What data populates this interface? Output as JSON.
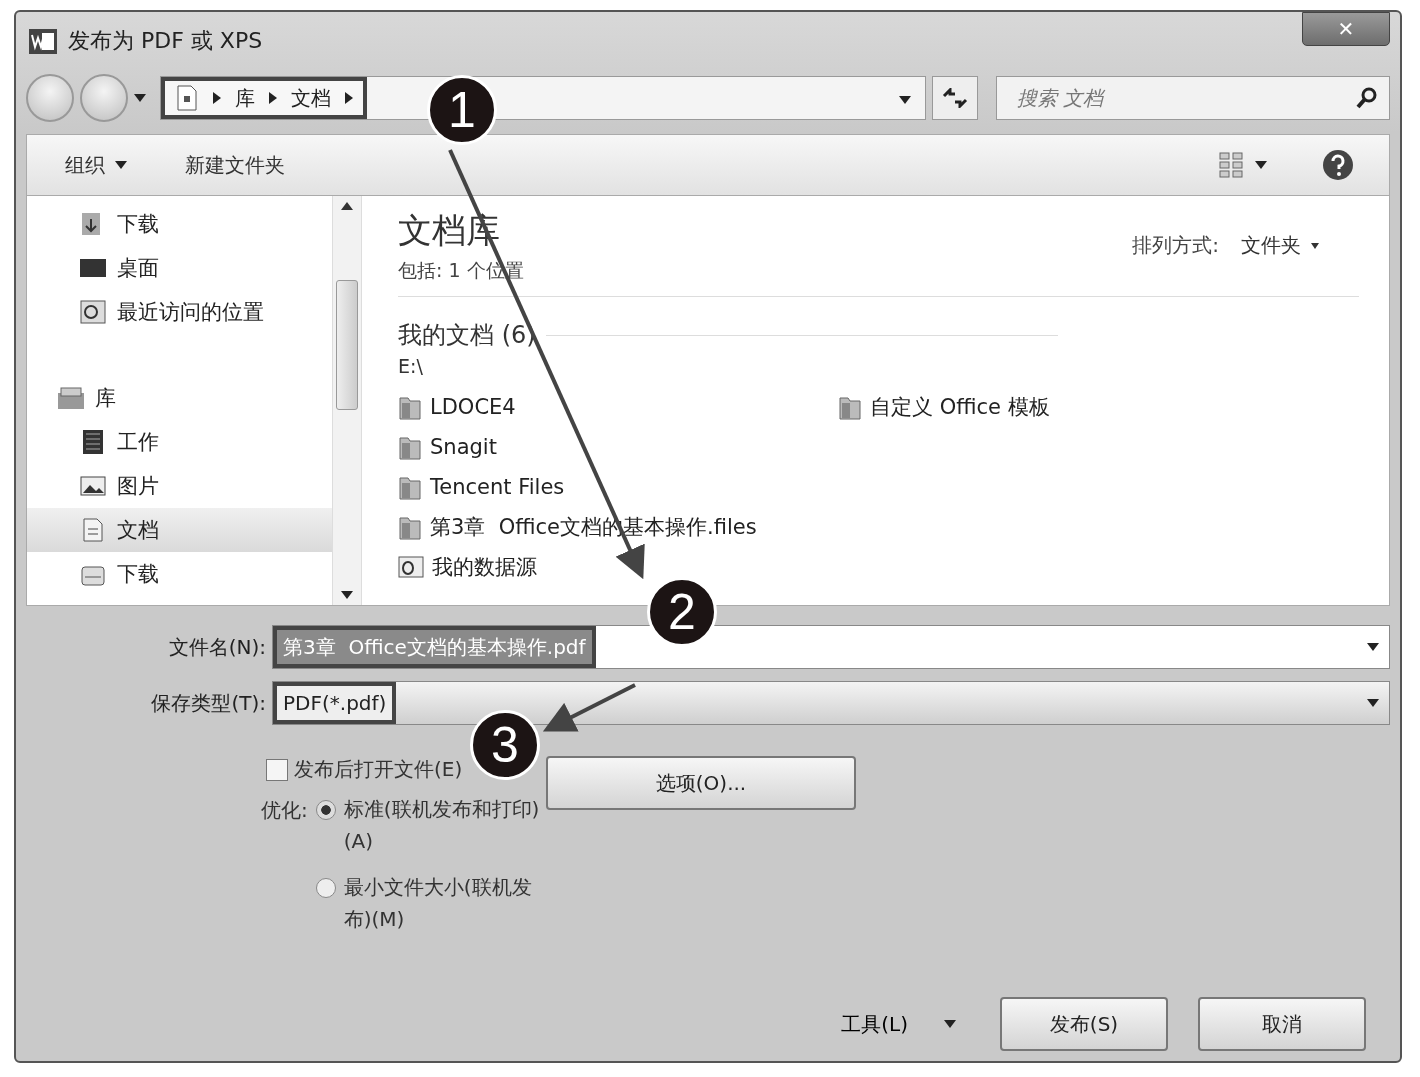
{
  "window": {
    "title": "发布为 PDF 或 XPS",
    "close": "✕"
  },
  "nav": {
    "breadcrumb": [
      "库",
      "文档"
    ],
    "search_placeholder": "搜索 文档"
  },
  "toolbar": {
    "items": [
      {
        "label": "组织",
        "dropdown": true
      },
      {
        "label": "新建文件夹",
        "dropdown": false
      }
    ]
  },
  "sidebar": {
    "items": [
      {
        "label": "下载",
        "selected": false
      },
      {
        "label": "桌面",
        "selected": false
      },
      {
        "label": "最近访问的位置",
        "selected": false
      },
      {
        "label": "库",
        "selected": false,
        "children": [
          {
            "label": "工作",
            "selected": false
          },
          {
            "label": "图片",
            "selected": false
          },
          {
            "label": "文档",
            "selected": true
          },
          {
            "label": "下载",
            "selected": false
          }
        ]
      }
    ]
  },
  "main": {
    "title": "文档库",
    "subtitle": "包括: 1 个位置",
    "arrange_label": "排列方式:",
    "arrange_value": "文件夹",
    "group": "我的文档 (6)",
    "path": "E:\\",
    "items": [
      {
        "label": "LDOCE4",
        "kind": "folder"
      },
      {
        "label": "Snagit",
        "kind": "folder"
      },
      {
        "label": "Tencent Files",
        "kind": "folder"
      },
      {
        "label": "第3章  Office文档的基本操作.files",
        "kind": "folder"
      },
      {
        "label": "我的数据源",
        "kind": "datasource"
      },
      {
        "label": "自定义 Office 模板",
        "kind": "folder"
      }
    ]
  },
  "form": {
    "file_name_label": "文件名(N):",
    "file_name": "第3章  Office文档的基本操作.pdf",
    "save_type_label": "保存类型(T):",
    "save_type": "PDF(*.pdf)",
    "open_after": {
      "label": "发布后打开文件(E)",
      "checked": false
    },
    "optimize_label": "优化:",
    "optimize": [
      {
        "label": "标准(联机发布和打印)(A)",
        "selected": true
      },
      {
        "label": "最小文件大小(联机发布)(M)",
        "selected": false
      }
    ],
    "options_button": "选项(O)..."
  },
  "footer": {
    "tools": "工具(L)",
    "buttons": [
      "发布(S)",
      "取消"
    ]
  },
  "callouts": [
    "1",
    "2",
    "3"
  ]
}
